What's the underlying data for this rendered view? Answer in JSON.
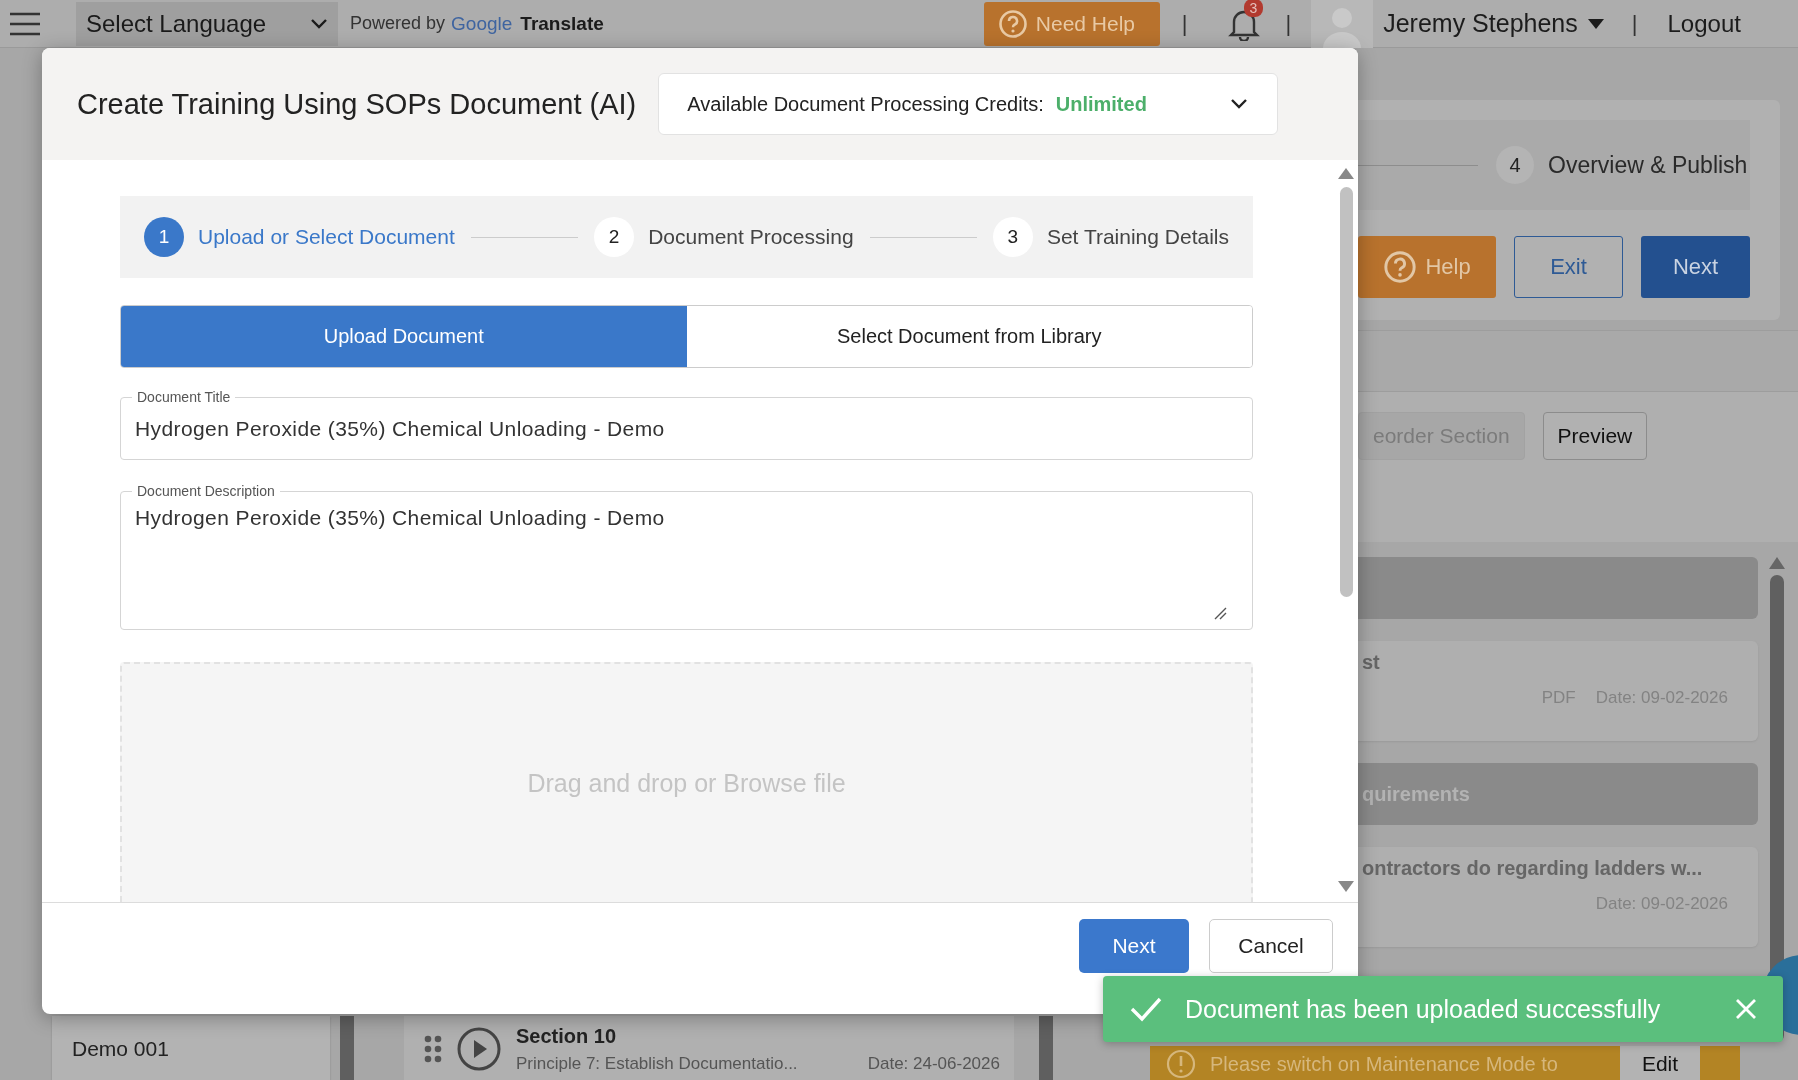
{
  "top_bar": {
    "language_select": "Select Language",
    "powered_by": "Powered by",
    "google": "Google",
    "translate": "Translate",
    "need_help": "Need Help",
    "separators": [
      "|",
      "|",
      "|"
    ],
    "notification_count": "3",
    "user_name": "Jeremy Stephens",
    "logout": "Logout"
  },
  "background": {
    "step": {
      "number": "4",
      "label": "Overview & Publish"
    },
    "buttons": [
      {
        "label": "Help",
        "kind": "help"
      },
      {
        "label": "Exit",
        "kind": "outline"
      },
      {
        "label": "Next",
        "kind": "primary"
      }
    ],
    "section_buttons": [
      {
        "label": "eorder Section",
        "disabled": true
      },
      {
        "label": "Preview",
        "disabled": false
      }
    ],
    "documents": [
      {
        "kind": "header"
      },
      {
        "kind": "card",
        "title": "st",
        "type": "PDF",
        "date": "Date: 09-02-2026"
      },
      {
        "kind": "header",
        "title": "quirements"
      },
      {
        "kind": "card",
        "title": "ontractors do regarding ladders w...",
        "date": "Date: 09-02-2026"
      }
    ],
    "maintenance": {
      "message": "Please switch on Maintenance Mode to",
      "action": "Edit"
    },
    "bottom": {
      "left_item": "Demo 001",
      "section": {
        "title": "Section 10",
        "subtitle": "Principle 7: Establish Documentatio...",
        "date": "Date: 24-06-2026"
      }
    }
  },
  "modal": {
    "title": "Create Training Using SOPs Document (AI)",
    "credits": {
      "label": "Available Document Processing Credits:",
      "value": "Unlimited"
    },
    "steps": [
      {
        "number": "1",
        "label": "Upload or Select Document",
        "selected": true
      },
      {
        "number": "2",
        "label": "Document Processing",
        "selected": false
      },
      {
        "number": "3",
        "label": "Set Training Details",
        "selected": false
      }
    ],
    "tabs": [
      {
        "label": "Upload Document",
        "selected": true
      },
      {
        "label": "Select Document from Library",
        "selected": false
      }
    ],
    "fields": [
      {
        "kind": "input",
        "label": "Document Title",
        "value": "Hydrogen Peroxide (35%) Chemical Unloading - Demo"
      },
      {
        "kind": "textarea",
        "label": "Document Description",
        "value": "Hydrogen Peroxide (35%) Chemical Unloading - Demo"
      }
    ],
    "dropzone": "Drag and drop or Browse file",
    "buttons": [
      {
        "label": "Next",
        "kind": "primary"
      },
      {
        "label": "Cancel",
        "kind": "secondary"
      }
    ]
  },
  "toast": {
    "message": "Document has been uploaded successfully"
  }
}
